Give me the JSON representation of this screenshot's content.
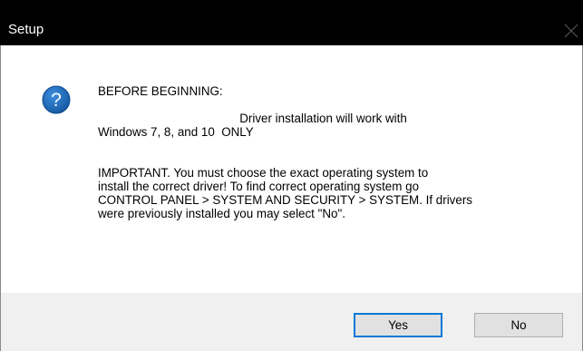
{
  "window": {
    "title": "Setup"
  },
  "dialog": {
    "icon": "question-icon",
    "message_lines": [
      "BEFORE BEGINNING:",
      "",
      "                                          Driver installation will work with",
      "Windows 7, 8, and 10  ONLY",
      "",
      "",
      "IMPORTANT. You must choose the exact operating system to",
      "install the correct driver! To find correct operating system go",
      "CONTROL PANEL > SYSTEM AND SECURITY > SYSTEM. If drivers",
      "were previously installed you may select \"No\"."
    ]
  },
  "buttons": {
    "yes_label": "Yes",
    "no_label": "No"
  },
  "colors": {
    "titlebar": "#000000",
    "icon_blue": "#1c6fc6",
    "default_button_border": "#0078d7",
    "footer_bg": "#f0f0f0"
  }
}
